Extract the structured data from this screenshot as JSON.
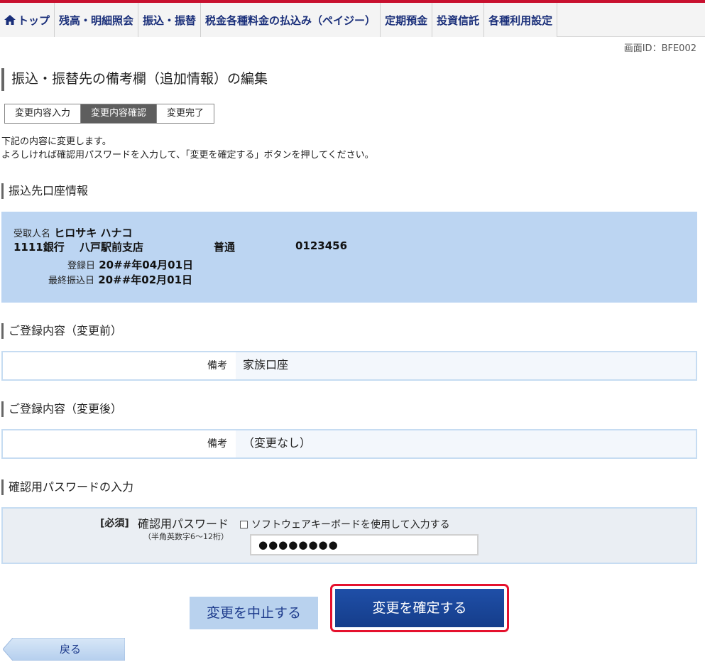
{
  "nav": {
    "items": [
      {
        "label": "トップ",
        "icon": "home-icon"
      },
      {
        "label": "残高・明細照会"
      },
      {
        "label": "振込・振替"
      },
      {
        "label": "税金各種料金の払込み（ペイジー）"
      },
      {
        "label": "定期預金"
      },
      {
        "label": "投資信託"
      },
      {
        "label": "各種利用設定"
      }
    ]
  },
  "screen_id": "画面ID：BFE002",
  "page_title": "振込・振替先の備考欄（追加情報）の編集",
  "steps": [
    "変更内容入力",
    "変更内容確認",
    "変更完了"
  ],
  "active_step": 1,
  "instructions": {
    "line1": "下記の内容に変更します。",
    "line2": "よろしければ確認用パスワードを入力して、「変更を確定する」ボタンを押してください。"
  },
  "account_section": {
    "heading": "振込先口座情報",
    "recipient_label": "受取人名",
    "recipient_name": "ヒロサキ ハナコ",
    "bank": "1111銀行",
    "branch": "八戸駅前支店",
    "account_type": "普通",
    "account_number": "0123456",
    "registered_label": "登録日",
    "registered_date": "20##年04月01日",
    "last_transfer_label": "最終振込日",
    "last_transfer_date": "20##年02月01日"
  },
  "before_section": {
    "heading": "ご登録内容（変更前）",
    "label": "備考",
    "value": "家族口座"
  },
  "after_section": {
    "heading": "ご登録内容（変更後）",
    "label": "備考",
    "value": "（変更なし）"
  },
  "password_section": {
    "heading": "確認用パスワードの入力",
    "required": "[必須]",
    "label": "確認用パスワード",
    "sublabel": "（半角英数字6～12桁）",
    "keyboard_option": "ソフトウェアキーボードを使用して入力する",
    "value": "●●●●●●●●"
  },
  "buttons": {
    "cancel": "変更を中止する",
    "confirm": "変更を確定する",
    "back": "戻る"
  },
  "colors": {
    "brand_red": "#c8102e",
    "nav_text": "#1a2f7a",
    "confirm_blue": "#1f4fa8",
    "highlight_red": "#e5112d",
    "account_bg": "#bcd5f2"
  }
}
